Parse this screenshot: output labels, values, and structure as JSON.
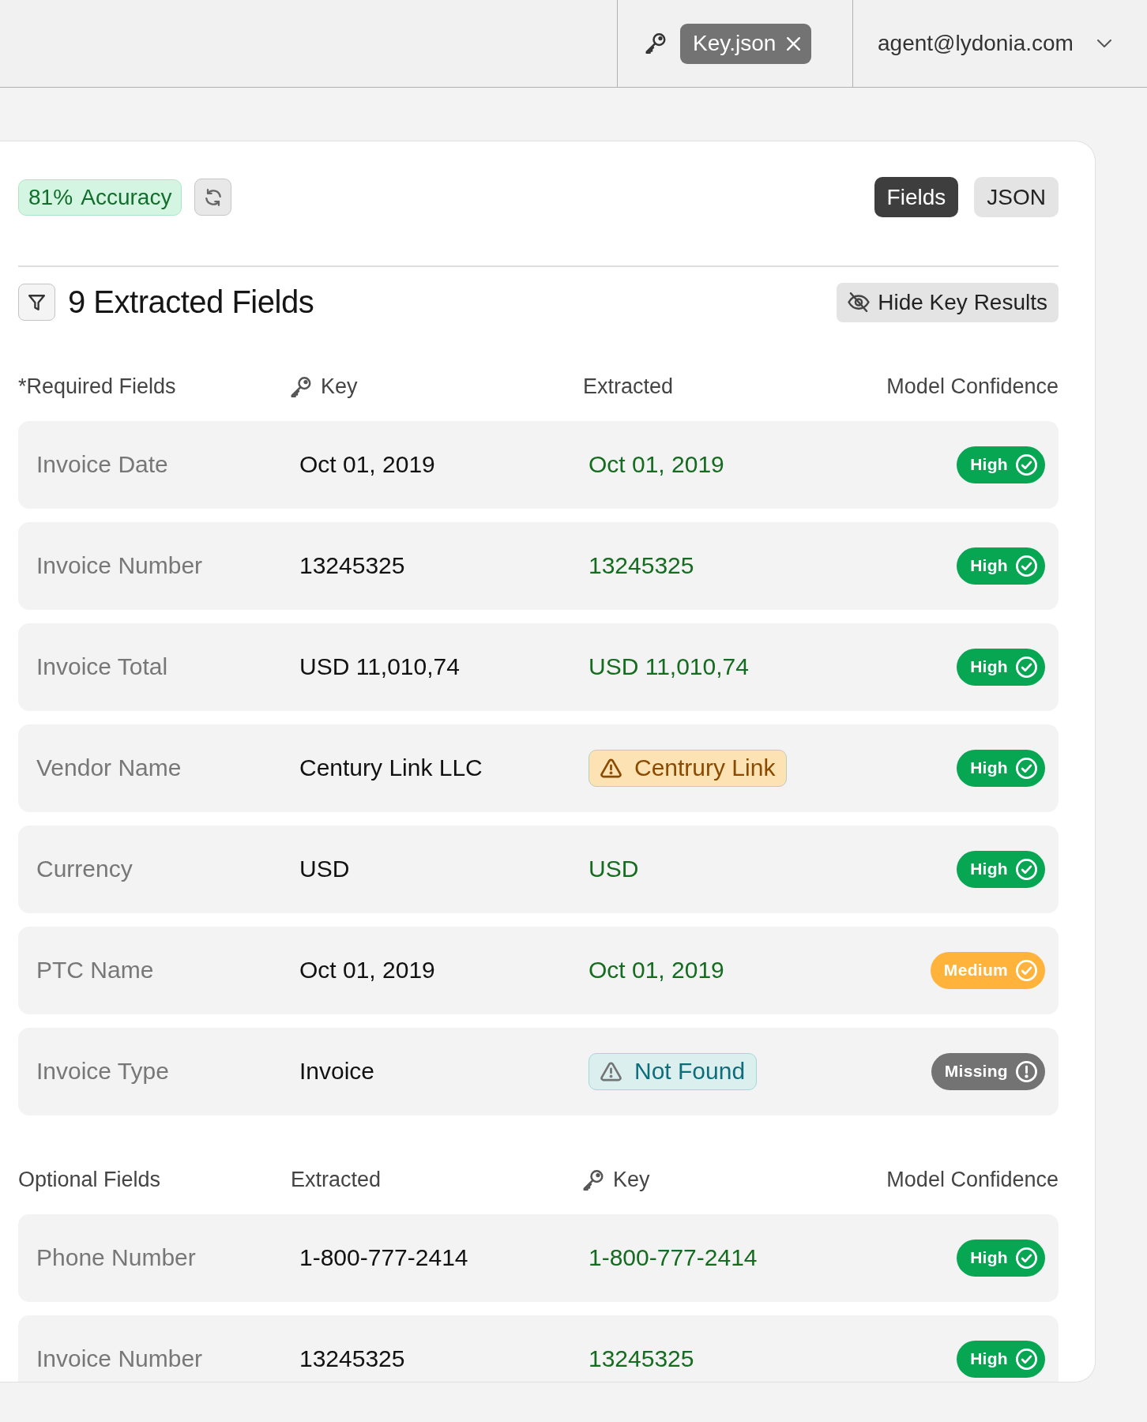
{
  "top_bar": {
    "file_chip": {
      "label": "Key.json"
    },
    "user": {
      "email": "agent@lydonia.com"
    }
  },
  "toolbar": {
    "accuracy": "81% Accuracy",
    "view_tabs": [
      {
        "label": "Fields",
        "selected": true
      },
      {
        "label": "JSON",
        "selected": false
      }
    ]
  },
  "fields_header": {
    "title": "9 Extracted Fields",
    "hide_button": "Hide Key Results"
  },
  "sections": [
    {
      "columns": [
        {
          "label": "*Required Fields",
          "kind": "text"
        },
        {
          "label": "Key",
          "kind": "key"
        },
        {
          "label": "Extracted",
          "kind": "text"
        },
        {
          "label": "Model Confidence",
          "kind": "text"
        }
      ],
      "rows": [
        {
          "field": "Invoice Date",
          "value": "Oct 01, 2019",
          "result": {
            "text": "Oct 01, 2019",
            "kind": "match"
          },
          "confidence": {
            "label": "High",
            "kind": "high"
          }
        },
        {
          "field": "Invoice Number",
          "value": "13245325",
          "result": {
            "text": "13245325",
            "kind": "match"
          },
          "confidence": {
            "label": "High",
            "kind": "high"
          }
        },
        {
          "field": "Invoice Total",
          "value": "USD 11,010,74",
          "result": {
            "text": "USD 11,010,74",
            "kind": "match"
          },
          "confidence": {
            "label": "High",
            "kind": "high"
          }
        },
        {
          "field": "Vendor Name",
          "value": "Century Link LLC",
          "result": {
            "text": "Centrury Link",
            "kind": "warning"
          },
          "confidence": {
            "label": "High",
            "kind": "high"
          }
        },
        {
          "field": "Currency",
          "value": "USD",
          "result": {
            "text": "USD",
            "kind": "match"
          },
          "confidence": {
            "label": "High",
            "kind": "high"
          }
        },
        {
          "field": "PTC Name",
          "value": "Oct 01, 2019",
          "result": {
            "text": "Oct 01, 2019",
            "kind": "match"
          },
          "confidence": {
            "label": "Medium",
            "kind": "medium"
          }
        },
        {
          "field": "Invoice Type",
          "value": "Invoice",
          "result": {
            "text": "Not Found",
            "kind": "not_found"
          },
          "confidence": {
            "label": "Missing",
            "kind": "missing"
          }
        }
      ]
    },
    {
      "columns": [
        {
          "label": "Optional Fields",
          "kind": "text"
        },
        {
          "label": "Extracted",
          "kind": "text"
        },
        {
          "label": "Key",
          "kind": "key"
        },
        {
          "label": "Model Confidence",
          "kind": "text"
        }
      ],
      "rows": [
        {
          "field": "Phone Number",
          "value": "1-800-777-2414",
          "result": {
            "text": "1-800-777-2414",
            "kind": "match"
          },
          "confidence": {
            "label": "High",
            "kind": "high"
          }
        },
        {
          "field": "Invoice Number",
          "value": "13245325",
          "result": {
            "text": "13245325",
            "kind": "match"
          },
          "confidence": {
            "label": "High",
            "kind": "high"
          }
        }
      ]
    }
  ]
}
